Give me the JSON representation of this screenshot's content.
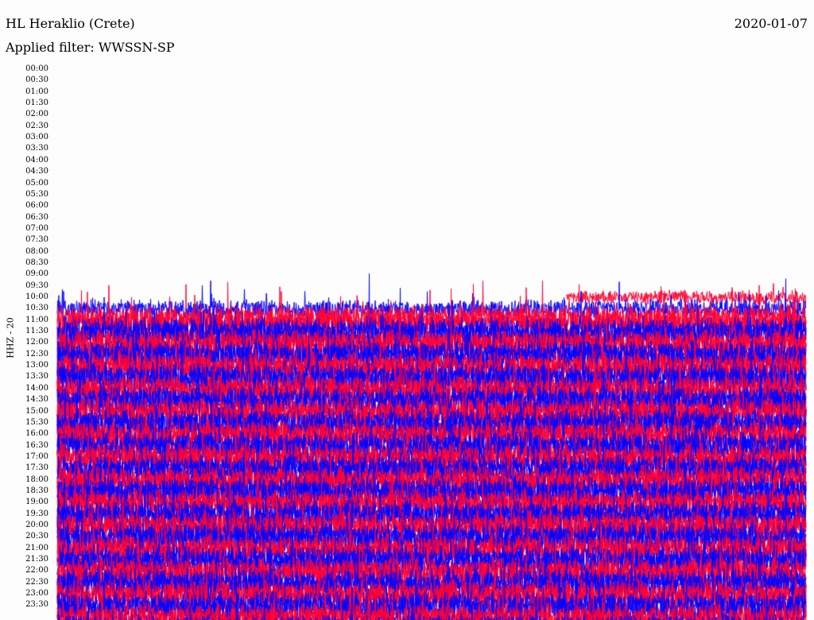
{
  "header": {
    "station": "HL Heraklio (Crete)",
    "date": "2020-01-07",
    "filter": "Applied filter: WWSSN-SP"
  },
  "channel_label": "HHZ - 20",
  "chart_data": {
    "type": "helicorder",
    "row_labels": [
      "00:00",
      "00:30",
      "01:00",
      "01:30",
      "02:00",
      "02:30",
      "03:00",
      "03:30",
      "04:00",
      "04:30",
      "05:00",
      "05:30",
      "06:00",
      "06:30",
      "07:00",
      "07:30",
      "08:00",
      "08:30",
      "09:00",
      "09:30",
      "10:00",
      "10:30",
      "11:00",
      "11:30",
      "12:00",
      "12:30",
      "13:00",
      "13:30",
      "14:00",
      "14:30",
      "15:00",
      "15:30",
      "16:00",
      "16:30",
      "17:00",
      "17:30",
      "18:00",
      "18:30",
      "19:00",
      "19:30",
      "20:00",
      "20:30",
      "21:00",
      "21:30",
      "22:00",
      "22:30",
      "23:00",
      "23:30"
    ],
    "row_interval_minutes": 30,
    "trace_colors": [
      "#0000ff",
      "#ff0033"
    ],
    "data_start_row": "10:00",
    "data_start_fraction_of_row": 0.68,
    "first_row_color": "#ff0033"
  }
}
